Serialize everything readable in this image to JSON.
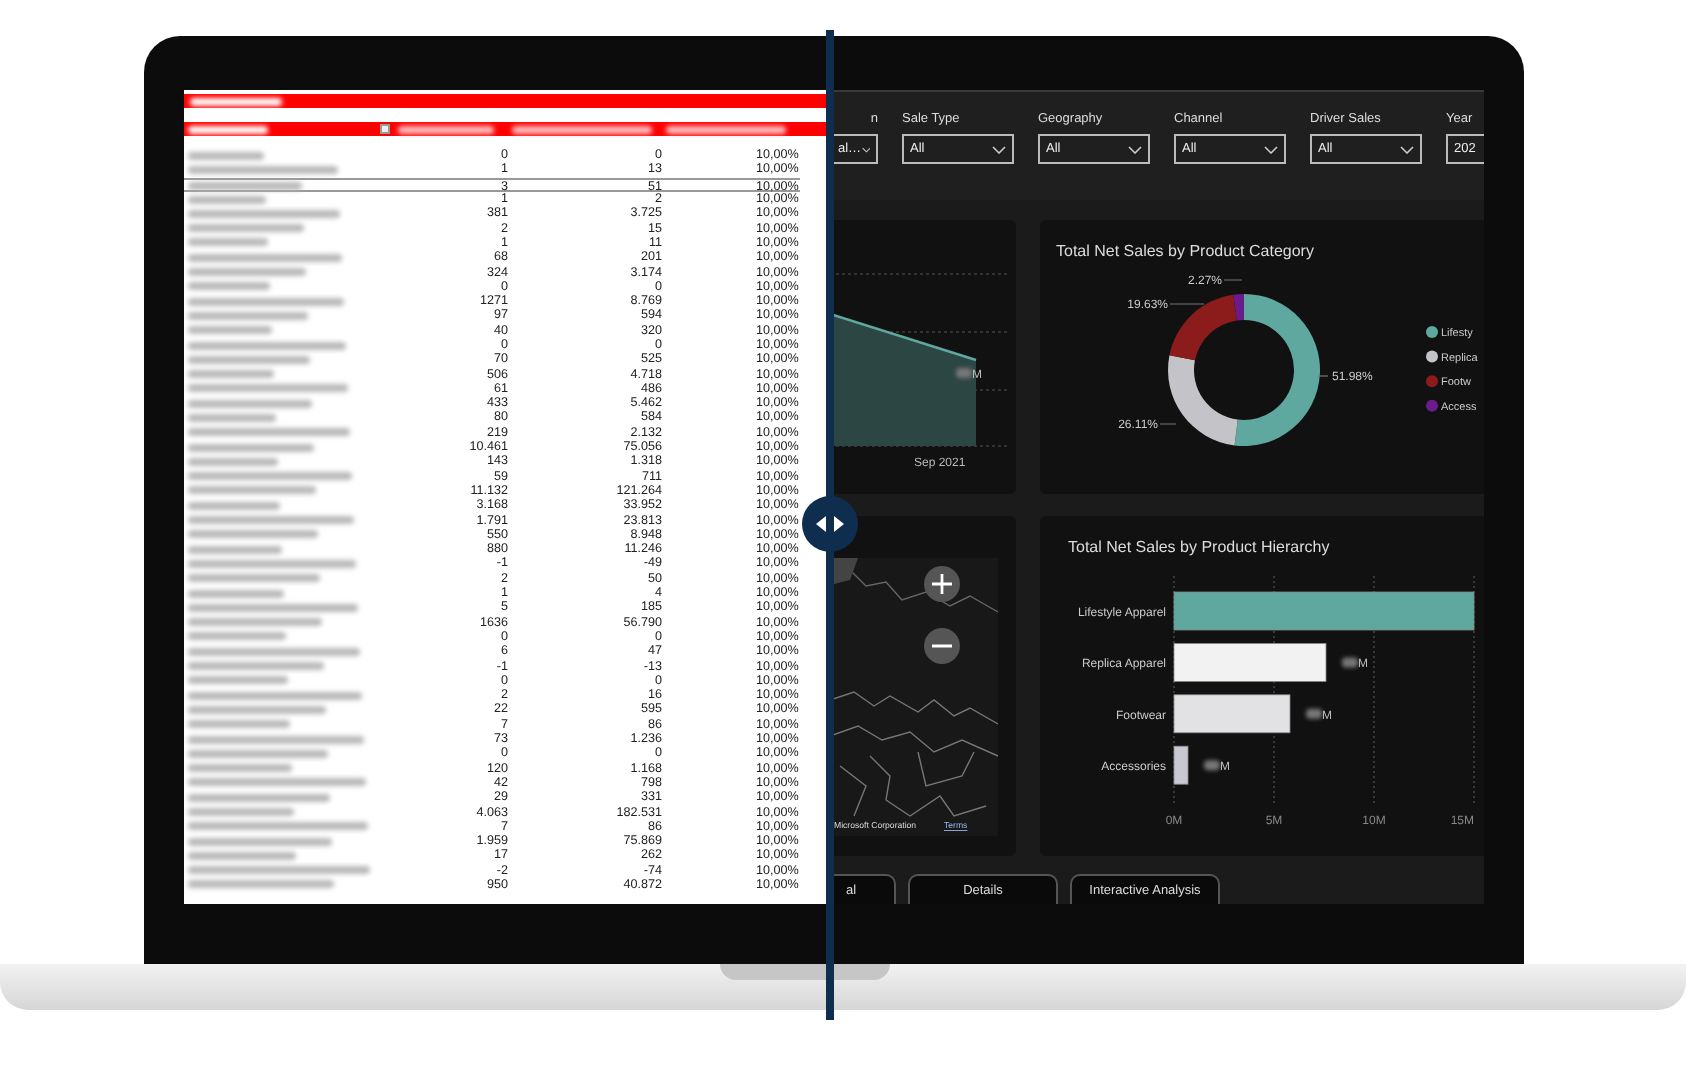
{
  "spreadsheet": {
    "rows": [
      {
        "col_2": "0",
        "col_3": "0",
        "col_4": "10,00%",
        "selected": false
      },
      {
        "col_2": "1",
        "col_3": "13",
        "col_4": "10,00%",
        "selected": false
      },
      {
        "col_2": "3",
        "col_3": "51",
        "col_4": "10,00%",
        "selected": true
      },
      {
        "col_2": "1",
        "col_3": "2",
        "col_4": "10,00%",
        "selected": false
      },
      {
        "col_2": "381",
        "col_3": "3.725",
        "col_4": "10,00%",
        "selected": false
      },
      {
        "col_2": "2",
        "col_3": "15",
        "col_4": "10,00%",
        "selected": false
      },
      {
        "col_2": "1",
        "col_3": "11",
        "col_4": "10,00%",
        "selected": false
      },
      {
        "col_2": "68",
        "col_3": "201",
        "col_4": "10,00%",
        "selected": false
      },
      {
        "col_2": "324",
        "col_3": "3.174",
        "col_4": "10,00%",
        "selected": false
      },
      {
        "col_2": "0",
        "col_3": "0",
        "col_4": "10,00%",
        "selected": false
      },
      {
        "col_2": "1271",
        "col_3": "8.769",
        "col_4": "10,00%",
        "selected": false
      },
      {
        "col_2": "97",
        "col_3": "594",
        "col_4": "10,00%",
        "selected": false
      },
      {
        "col_2": "40",
        "col_3": "320",
        "col_4": "10,00%",
        "selected": false
      },
      {
        "col_2": "0",
        "col_3": "0",
        "col_4": "10,00%",
        "selected": false
      },
      {
        "col_2": "70",
        "col_3": "525",
        "col_4": "10,00%",
        "selected": false
      },
      {
        "col_2": "506",
        "col_3": "4.718",
        "col_4": "10,00%",
        "selected": false
      },
      {
        "col_2": "61",
        "col_3": "486",
        "col_4": "10,00%",
        "selected": false
      },
      {
        "col_2": "433",
        "col_3": "5.462",
        "col_4": "10,00%",
        "selected": false
      },
      {
        "col_2": "80",
        "col_3": "584",
        "col_4": "10,00%",
        "selected": false
      },
      {
        "col_2": "219",
        "col_3": "2.132",
        "col_4": "10,00%",
        "selected": false
      },
      {
        "col_2": "10.461",
        "col_3": "75.056",
        "col_4": "10,00%",
        "selected": false
      },
      {
        "col_2": "143",
        "col_3": "1.318",
        "col_4": "10,00%",
        "selected": false
      },
      {
        "col_2": "59",
        "col_3": "711",
        "col_4": "10,00%",
        "selected": false
      },
      {
        "col_2": "11.132",
        "col_3": "121.264",
        "col_4": "10,00%",
        "selected": false
      },
      {
        "col_2": "3.168",
        "col_3": "33.952",
        "col_4": "10,00%",
        "selected": false
      },
      {
        "col_2": "1.791",
        "col_3": "23.813",
        "col_4": "10,00%",
        "selected": false
      },
      {
        "col_2": "550",
        "col_3": "8.948",
        "col_4": "10,00%",
        "selected": false
      },
      {
        "col_2": "880",
        "col_3": "11.246",
        "col_4": "10,00%",
        "selected": false
      },
      {
        "col_2": "-1",
        "col_3": "-49",
        "col_4": "10,00%",
        "selected": false
      },
      {
        "col_2": "2",
        "col_3": "50",
        "col_4": "10,00%",
        "selected": false
      },
      {
        "col_2": "1",
        "col_3": "4",
        "col_4": "10,00%",
        "selected": false
      },
      {
        "col_2": "5",
        "col_3": "185",
        "col_4": "10,00%",
        "selected": false
      },
      {
        "col_2": "1636",
        "col_3": "56.790",
        "col_4": "10,00%",
        "selected": false
      },
      {
        "col_2": "0",
        "col_3": "0",
        "col_4": "10,00%",
        "selected": false
      },
      {
        "col_2": "6",
        "col_3": "47",
        "col_4": "10,00%",
        "selected": false
      },
      {
        "col_2": "-1",
        "col_3": "-13",
        "col_4": "10,00%",
        "selected": false
      },
      {
        "col_2": "0",
        "col_3": "0",
        "col_4": "10,00%",
        "selected": false
      },
      {
        "col_2": "2",
        "col_3": "16",
        "col_4": "10,00%",
        "selected": false
      },
      {
        "col_2": "22",
        "col_3": "595",
        "col_4": "10,00%",
        "selected": false
      },
      {
        "col_2": "7",
        "col_3": "86",
        "col_4": "10,00%",
        "selected": false
      },
      {
        "col_2": "73",
        "col_3": "1.236",
        "col_4": "10,00%",
        "selected": false
      },
      {
        "col_2": "0",
        "col_3": "0",
        "col_4": "10,00%",
        "selected": false
      },
      {
        "col_2": "120",
        "col_3": "1.168",
        "col_4": "10,00%",
        "selected": false
      },
      {
        "col_2": "42",
        "col_3": "798",
        "col_4": "10,00%",
        "selected": false
      },
      {
        "col_2": "29",
        "col_3": "331",
        "col_4": "10,00%",
        "selected": false
      },
      {
        "col_2": "4.063",
        "col_3": "182.531",
        "col_4": "10,00%",
        "selected": false
      },
      {
        "col_2": "7",
        "col_3": "86",
        "col_4": "10,00%",
        "selected": false
      },
      {
        "col_2": "1.959",
        "col_3": "75.869",
        "col_4": "10,00%",
        "selected": false
      },
      {
        "col_2": "17",
        "col_3": "262",
        "col_4": "10,00%",
        "selected": false
      },
      {
        "col_2": "-2",
        "col_3": "-74",
        "col_4": "10,00%",
        "selected": false
      },
      {
        "col_2": "950",
        "col_3": "40.872",
        "col_4": "10,00%",
        "selected": false
      }
    ]
  },
  "dashboard": {
    "slicers": [
      {
        "label": "n",
        "value": "al…"
      },
      {
        "label": "Sale Type",
        "value": "All"
      },
      {
        "label": "Geography",
        "value": "All"
      },
      {
        "label": "Channel",
        "value": "All"
      },
      {
        "label": "Driver Sales",
        "value": "All"
      },
      {
        "label": "Year",
        "value": "202"
      }
    ],
    "trend_card": {
      "x_label": "Sep 2021",
      "value_label": "M"
    },
    "category_card": {
      "chart_data": {
        "type": "donut",
        "title": "Total Net Sales by Product Category",
        "categories": [
          "Lifesty",
          "Replica",
          "Footw",
          "Access"
        ],
        "series": [
          {
            "values": [
              51.98,
              26.11,
              19.63,
              2.27
            ]
          }
        ],
        "value_labels": [
          "51.98%",
          "26.11%",
          "19.63%",
          "2.27%"
        ],
        "legend": true
      },
      "slices": [
        {
          "color": "#5fa8a0"
        },
        {
          "color": "#c4c4c8"
        },
        {
          "color": "#8c1c1c"
        },
        {
          "color": "#6a1b8c"
        }
      ]
    },
    "map_card": {
      "attribution": "Microsoft Corporation",
      "link": "Terms"
    },
    "hierarchy_card": {
      "chart_data": {
        "type": "bar",
        "orientation": "horizontal",
        "title": "Total Net Sales by Product Hierarchy",
        "categories": [
          "Lifestyle Apparel",
          "Replica Apparel",
          "Footwear",
          "Accessories"
        ],
        "series": [
          {
            "values": [
              15,
              7.6,
              5.8,
              0.7
            ]
          }
        ],
        "xlim": [
          0,
          15
        ],
        "xticks": [
          {
            "value": 0,
            "label": "0M"
          },
          {
            "value": 5,
            "label": "5M"
          },
          {
            "value": 10,
            "label": "10M"
          },
          {
            "value": 15,
            "label": "15M"
          }
        ],
        "value_labels": [
          null,
          "M",
          "M",
          "M"
        ]
      },
      "bars": [
        {
          "color": "#5fa8a0"
        },
        {
          "color": "#f2f2f2"
        },
        {
          "color": "#e2e2e4"
        },
        {
          "color": "#c8c8d2"
        }
      ]
    },
    "page_tabs": [
      {
        "label": "al"
      },
      {
        "label": "Details"
      },
      {
        "label": "Interactive Analysis"
      }
    ]
  }
}
